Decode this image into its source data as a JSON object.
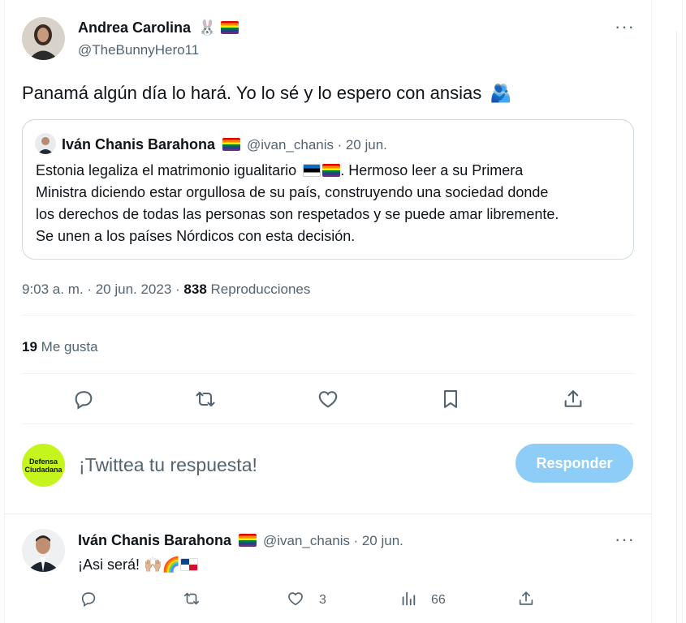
{
  "main_tweet": {
    "author_name": "Andrea Carolina",
    "author_handle": "@TheBunnyHero11",
    "author_emoji": "🐰",
    "text": "Panamá algún día lo hará. Yo lo sé y lo espero con ansias",
    "text_emoji": "🫂",
    "time": "9:03 a. m. · 20 jun. 2023 ·",
    "views_count": "838",
    "views_label": "Reproducciones",
    "likes_count": "19",
    "likes_label": "Me gusta",
    "more_label": "···"
  },
  "quoted_tweet": {
    "author_name": "Iván Chanis Barahona",
    "author_handle": "@ivan_chanis",
    "date": "· 20 jun.",
    "text_before_flags": "Estonia legaliza el matrimonio igualitario",
    "text_after_flags": ". Hermoso leer a su Primera",
    "text_line2": "Ministra diciendo estar orgullosa de su país, construyendo una sociedad donde",
    "text_line3": "los derechos de todas las personas son respetados y se puede amar libremente.",
    "text_line4": "Se unen a los países Nórdicos con esta decisión."
  },
  "actions": {
    "icons": [
      "reply-icon",
      "retweet-icon",
      "like-icon",
      "bookmark-icon",
      "share-icon"
    ]
  },
  "composer": {
    "avatar_line1": "Defensa",
    "avatar_line2": "Ciudadana",
    "placeholder": "¡Twittea tu respuesta!",
    "reply_button": "Responder"
  },
  "reply_tweet": {
    "author_name": "Iván Chanis Barahona",
    "author_handle": "@ivan_chanis",
    "date": "· 20 jun.",
    "text": "¡Asi será!",
    "text_emoji": "🙌🏼🌈",
    "likes_count": "3",
    "views_count": "66",
    "more_label": "···"
  },
  "colors": {
    "accent_disabled": "#8ecdf7",
    "secondary_text": "#536471",
    "border": "#cfd9de",
    "brand_green": "#c6f51e"
  }
}
